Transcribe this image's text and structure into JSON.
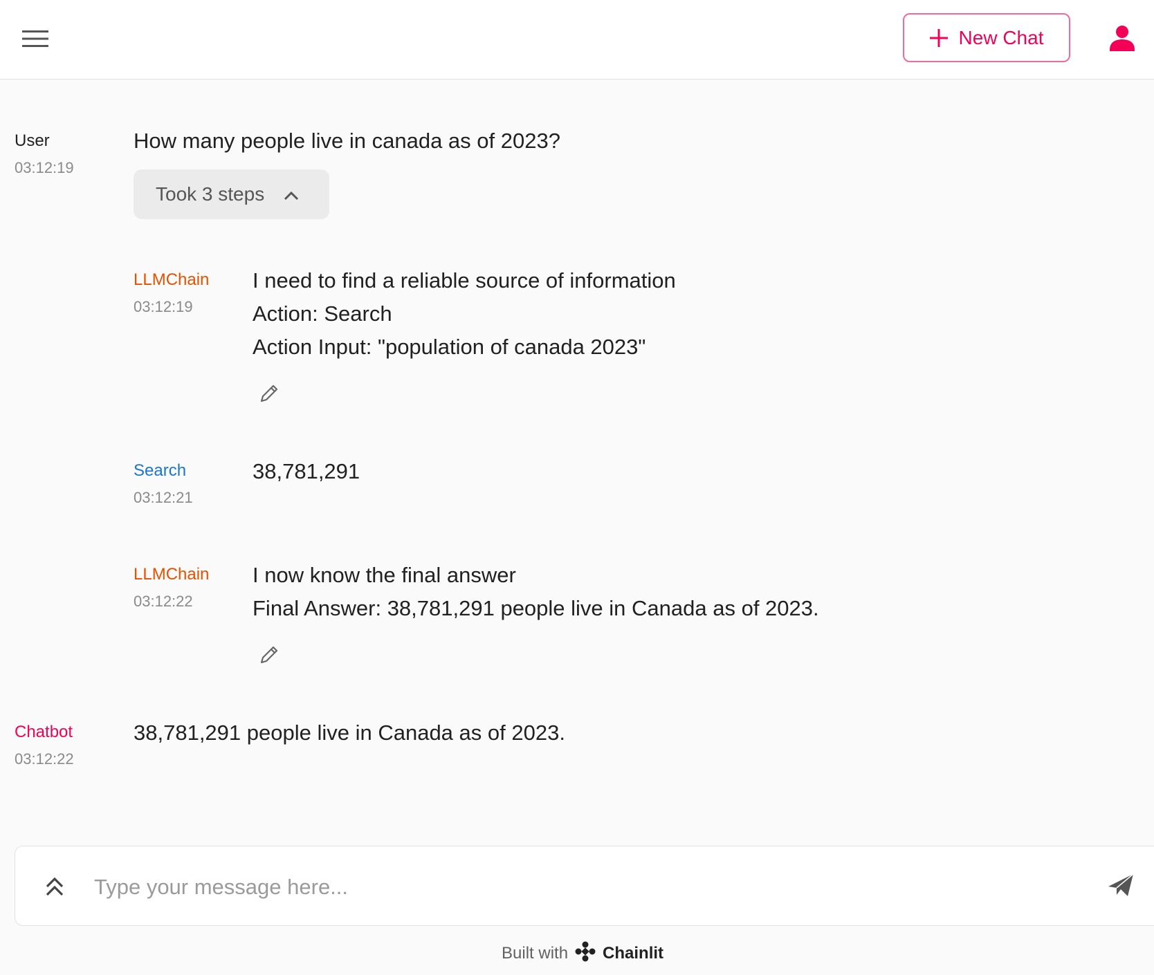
{
  "header": {
    "new_chat_label": "New Chat"
  },
  "messages": {
    "user": {
      "author": "User",
      "time": "03:12:19",
      "text": "How many people live in canada as of 2023?"
    },
    "steps_toggle": "Took 3 steps",
    "step1": {
      "author": "LLMChain",
      "time": "03:12:19",
      "lines": [
        "I need to find a reliable source of information",
        "Action: Search",
        "Action Input: \"population of canada 2023\""
      ]
    },
    "step2": {
      "author": "Search",
      "time": "03:12:21",
      "text": "38,781,291"
    },
    "step3": {
      "author": "LLMChain",
      "time": "03:12:22",
      "lines": [
        "I now know the final answer",
        "Final Answer: 38,781,291 people live in Canada as of 2023."
      ]
    },
    "bot": {
      "author": "Chatbot",
      "time": "03:12:22",
      "text": "38,781,291 people live in Canada as of 2023."
    }
  },
  "composer": {
    "placeholder": "Type your message here..."
  },
  "footer": {
    "built_with": "Built with",
    "brand": "Chainlit"
  },
  "colors": {
    "accent": "#f50057",
    "llmchain": "#e65100",
    "search": "#1976d2"
  },
  "icons": {
    "menu": "hamburger-menu-icon",
    "new_chat": "plus-icon",
    "user": "user-avatar-icon",
    "steps": "chevron-up-icon",
    "edit": "pencil-icon",
    "history": "double-chevron-up-icon",
    "send": "paper-plane-icon",
    "logo": "chainlit-logo-icon"
  }
}
